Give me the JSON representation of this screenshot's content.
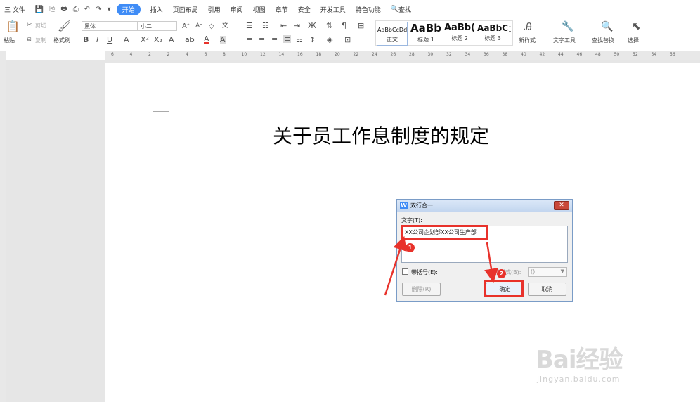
{
  "menu": {
    "file": "三 文件",
    "quick_icons": [
      "💾",
      "⎘",
      "🖶",
      "⎙",
      "↶",
      "↷",
      "▾"
    ],
    "tabs": [
      "开始",
      "插入",
      "页面布局",
      "引用",
      "审阅",
      "视图",
      "章节",
      "安全",
      "开发工具",
      "特色功能"
    ],
    "search": "查找"
  },
  "ribbon": {
    "paste": "粘贴",
    "cut": "剪切",
    "copy": "复制",
    "format_painter": "格式刷",
    "font_name": "黑体",
    "font_size": "小二",
    "styles": [
      {
        "preview": "AaBbCcDd",
        "label": "正文"
      },
      {
        "preview": "AaBb",
        "label": "标题 1"
      },
      {
        "preview": "AaBb(",
        "label": "标题 2"
      },
      {
        "preview": "AaBbC",
        "label": "标题 3"
      }
    ],
    "new_style": "新样式",
    "text_tools": "文字工具",
    "find_replace": "查找替换",
    "select": "选择"
  },
  "ruler": {
    "ticks": [
      "6",
      "4",
      "2",
      "2",
      "4",
      "6",
      "8",
      "10",
      "12",
      "14",
      "16",
      "18",
      "20",
      "22",
      "24",
      "26",
      "28",
      "30",
      "32",
      "34",
      "36",
      "38",
      "40",
      "42",
      "44",
      "46",
      "48",
      "50",
      "52",
      "54",
      "56"
    ]
  },
  "document": {
    "title": "关于员工作息制度的规定"
  },
  "dialog": {
    "title": "双行合一",
    "text_label": "文字(T):",
    "text_value": "XX公司企划部XX公司生产部",
    "bracket_label": "带括号(E):",
    "bracket_style_label": "括号样式(B):",
    "bracket_style_value": "()",
    "delete": "删除(R)",
    "ok": "确定",
    "cancel": "取消"
  },
  "annotations": {
    "badge1": "1",
    "badge2": "2",
    "highlight_color": "#e8322b"
  },
  "watermark": {
    "brand": "Bai经验",
    "url": "jingyan.baidu.com"
  },
  "colors": {
    "accent": "#3f8cf6",
    "dialog_border": "#7a9cc7"
  }
}
